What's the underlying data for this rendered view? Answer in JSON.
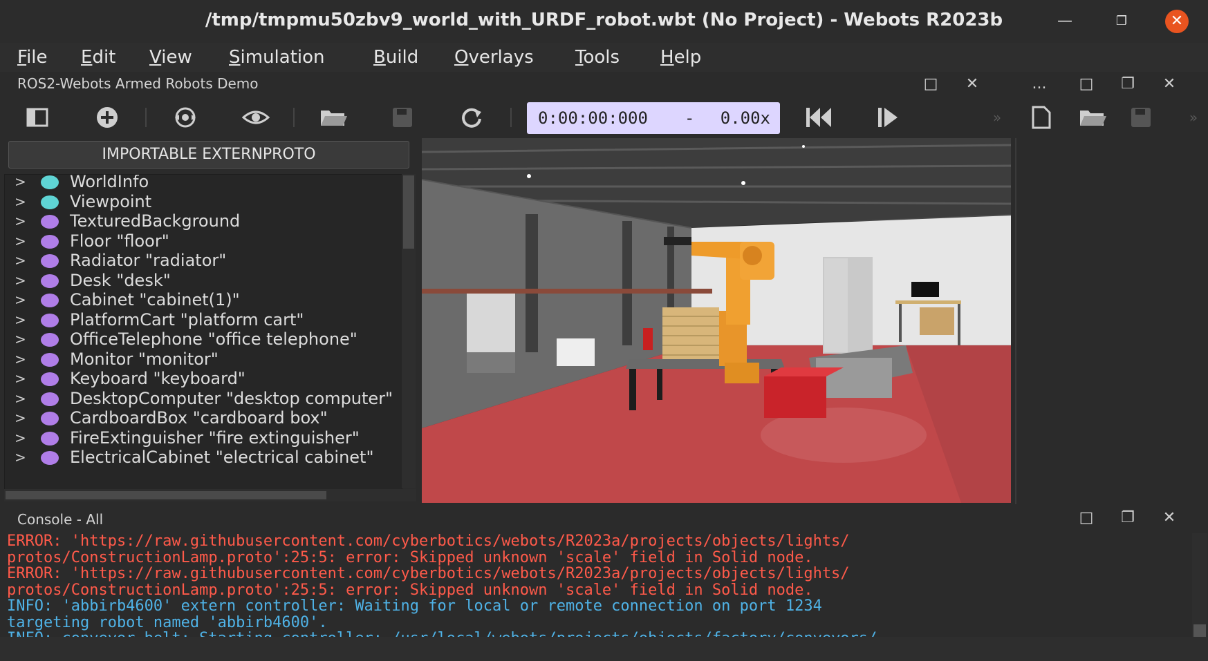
{
  "window": {
    "title": "/tmp/tmpmu50zbv9_world_with_URDF_robot.wbt (No Project) - Webots R2023b",
    "minimize": "—",
    "maximize": "❐",
    "close": "✕"
  },
  "menu": [
    "File",
    "Edit",
    "View",
    "Simulation",
    "Build",
    "Overlays",
    "Tools",
    "Help"
  ],
  "scene_dock": {
    "title": "ROS2-Webots Armed Robots Demo",
    "dock_restore": "□",
    "dock_close": "✕"
  },
  "editor_dock": {
    "more": "...",
    "dock_max": "□",
    "dock_restore": "❐",
    "dock_close": "✕"
  },
  "toolbar": {
    "simulation_time": "0:00:00:000",
    "dash": "-",
    "speed": "0.00x"
  },
  "scene_tree": {
    "import_button": "IMPORTABLE EXTERNPROTO",
    "nodes": [
      {
        "label": "WorldInfo",
        "color": "#5fd4d4"
      },
      {
        "label": "Viewpoint",
        "color": "#5fd4d4"
      },
      {
        "label": "TexturedBackground",
        "color": "#b07ee8"
      },
      {
        "label": "Floor \"floor\"",
        "color": "#b07ee8"
      },
      {
        "label": "Radiator \"radiator\"",
        "color": "#b07ee8"
      },
      {
        "label": "Desk \"desk\"",
        "color": "#b07ee8"
      },
      {
        "label": "Cabinet \"cabinet(1)\"",
        "color": "#b07ee8"
      },
      {
        "label": "PlatformCart \"platform cart\"",
        "color": "#b07ee8"
      },
      {
        "label": "OfficeTelephone \"office telephone\"",
        "color": "#b07ee8"
      },
      {
        "label": "Monitor \"monitor\"",
        "color": "#b07ee8"
      },
      {
        "label": "Keyboard \"keyboard\"",
        "color": "#b07ee8"
      },
      {
        "label": "DesktopComputer \"desktop computer\"",
        "color": "#b07ee8"
      },
      {
        "label": "CardboardBox \"cardboard box\"",
        "color": "#b07ee8"
      },
      {
        "label": "FireExtinguisher \"fire extinguisher\"",
        "color": "#b07ee8"
      },
      {
        "label": "ElectricalCabinet \"electrical cabinet\"",
        "color": "#b07ee8"
      }
    ]
  },
  "console": {
    "title": "Console - All",
    "lines": [
      {
        "kind": "err",
        "text": "ERROR: 'https://raw.githubusercontent.com/cyberbotics/webots/R2023a/projects/objects/lights/"
      },
      {
        "kind": "err",
        "text": "protos/ConstructionLamp.proto':25:5: error: Skipped unknown 'scale' field in Solid node."
      },
      {
        "kind": "err",
        "text": "ERROR: 'https://raw.githubusercontent.com/cyberbotics/webots/R2023a/projects/objects/lights/"
      },
      {
        "kind": "err",
        "text": "protos/ConstructionLamp.proto':25:5: error: Skipped unknown 'scale' field in Solid node."
      },
      {
        "kind": "info",
        "text": "INFO: 'abbirb4600' extern controller: Waiting for local or remote connection on port 1234"
      },
      {
        "kind": "info",
        "text": "targeting robot named 'abbirb4600'."
      },
      {
        "kind": "info",
        "text": "INFO: conveyor_belt: Starting controller: /usr/local/webots/projects/objects/factory/conveyors/"
      }
    ]
  }
}
